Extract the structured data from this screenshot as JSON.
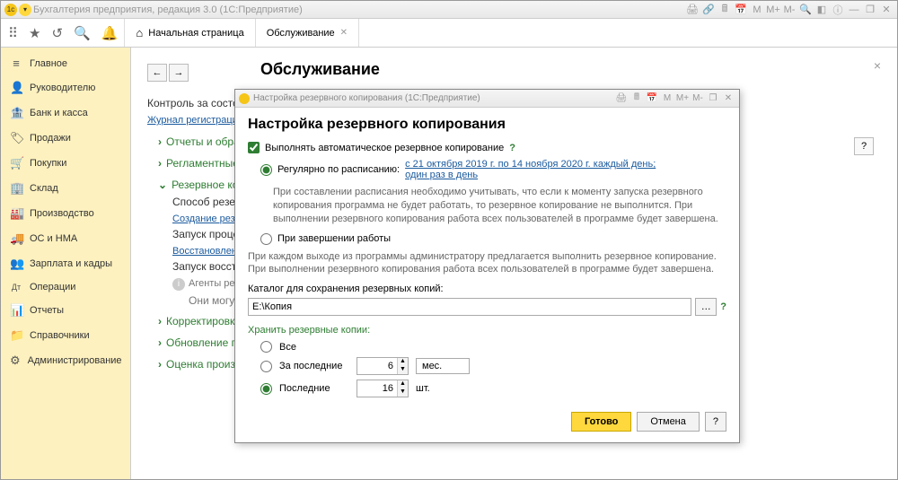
{
  "window": {
    "title": "Бухгалтерия предприятия, редакция 3.0  (1С:Предприятие)"
  },
  "toolbarTabs": {
    "home": "Начальная страница",
    "service": "Обслуживание"
  },
  "sidebar": {
    "items": [
      {
        "icon": "≡",
        "label": "Главное"
      },
      {
        "icon": "👤",
        "label": "Руководителю"
      },
      {
        "icon": "🏦",
        "label": "Банк и касса"
      },
      {
        "icon": "🏷",
        "label": "Продажи"
      },
      {
        "icon": "🛒",
        "label": "Покупки"
      },
      {
        "icon": "🏢",
        "label": "Склад"
      },
      {
        "icon": "🏭",
        "label": "Производство"
      },
      {
        "icon": "🚚",
        "label": "ОС и НМА"
      },
      {
        "icon": "👥",
        "label": "Зарплата и кадры"
      },
      {
        "icon": "Дт",
        "label": "Операции"
      },
      {
        "icon": "📊",
        "label": "Отчеты"
      },
      {
        "icon": "📁",
        "label": "Справочники"
      },
      {
        "icon": "⚙",
        "label": "Администрирование"
      }
    ]
  },
  "content": {
    "heading": "Обслуживание",
    "control_label": "Контроль за состояние",
    "journal_link": "Журнал регистрации",
    "tree": {
      "n1": "Отчеты и обраб",
      "n2": "Регламентные о",
      "n3": "Резервное копи",
      "n3_sub1": "Способ резервного к",
      "n3_link1": "Создание резервной",
      "n3_sub2": "Запуск процедуры с",
      "n3_link2": "Восстановление из р",
      "n3_sub3": "Запуск восстановлен",
      "n3_sub4a": "Агенты резервн",
      "n3_sub4b": "Они могут прод",
      "n4": "Корректировка",
      "n5": "Обновление про",
      "n6": "Оценка произво"
    }
  },
  "modal": {
    "titlebar": "Настройка резервного копирования  (1С:Предприятие)",
    "heading": "Настройка резервного копирования",
    "chk_auto": "Выполнять автоматическое резервное копирование",
    "radio_schedule": "Регулярно по расписанию:",
    "schedule_link": "с 21 октября 2019 г. по 14 ноября 2020 г. каждый день; один раз в день",
    "desc1": "При составлении расписания необходимо учитывать, что если к моменту запуска резервного копирования программа не будет работать, то резервное копирование не выполнится. При выполнении резервного копирования работа всех пользователей в программе будет завершена.",
    "radio_onexit": "При завершении работы",
    "desc2": "При каждом выходе из программы администратору предлагается выполнить резервное копирование. При выполнении резервного копирования работа всех пользователей в программе будет завершена.",
    "catalog_label": "Каталог для сохранения резервных копий:",
    "catalog_value": "E:\\Копия",
    "retain_label": "Хранить резервные копии:",
    "radio_all": "Все",
    "radio_lastN": "За последние",
    "lastN_value": "6",
    "lastN_unit": "мес.",
    "radio_lastCount": "Последние",
    "lastCount_value": "16",
    "lastCount_unit": "шт.",
    "btn_ready": "Готово",
    "btn_cancel": "Отмена",
    "btn_help": "?"
  }
}
